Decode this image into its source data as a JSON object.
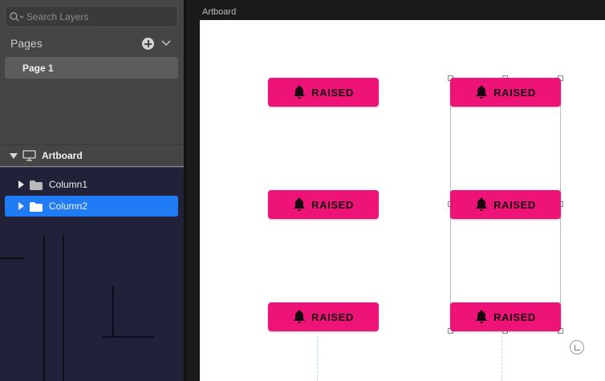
{
  "sidebar": {
    "search": {
      "placeholder": "Search Layers"
    },
    "pages": {
      "title": "Pages",
      "items": [
        {
          "label": "Page 1",
          "selected": true
        }
      ]
    },
    "artboard": {
      "label": "Artboard",
      "icon": "monitor-icon"
    },
    "layers": [
      {
        "label": "Column1",
        "icon": "folder-icon",
        "selected": false
      },
      {
        "label": "Column2",
        "icon": "folder-icon",
        "selected": true
      }
    ]
  },
  "canvas": {
    "artboard_title": "Artboard",
    "buttons": [
      {
        "label": "RAISED",
        "icon": "bell-icon"
      },
      {
        "label": "RAISED",
        "icon": "bell-icon"
      },
      {
        "label": "RAISED",
        "icon": "bell-icon"
      },
      {
        "label": "RAISED",
        "icon": "bell-icon"
      },
      {
        "label": "RAISED",
        "icon": "bell-icon"
      },
      {
        "label": "RAISED",
        "icon": "bell-icon"
      }
    ]
  },
  "colors": {
    "accent": "#ee1377",
    "selection": "#1f7cf5",
    "sidebar_bg": "#454545",
    "layers_bg": "#21213a"
  }
}
